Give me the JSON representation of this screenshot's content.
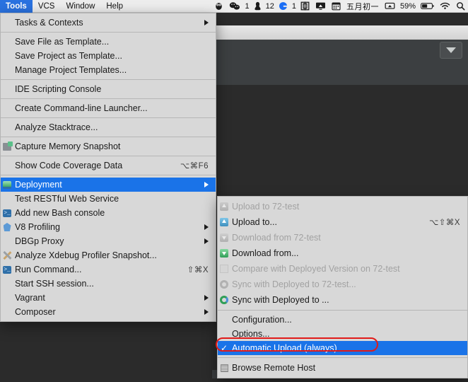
{
  "menubar": {
    "items": [
      {
        "label": "Tools",
        "active": true
      },
      {
        "label": "VCS",
        "active": false
      },
      {
        "label": "Window",
        "active": false
      },
      {
        "label": "Help",
        "active": false
      }
    ],
    "status_items": [
      {
        "name": "qq-penguin-icon",
        "glyph": "☻",
        "text": ""
      },
      {
        "name": "wechat-icon",
        "glyph": "◕◔",
        "text": "1"
      },
      {
        "name": "qq-contact-icon",
        "glyph": "♟",
        "text": "12"
      },
      {
        "name": "grammarly-icon",
        "glyph": "G",
        "text": "1"
      },
      {
        "name": "input-source-chinese-icon",
        "glyph": "中",
        "text": ""
      },
      {
        "name": "airplay-display-icon",
        "glyph": "⌷",
        "text": ""
      },
      {
        "name": "calendar-icon",
        "glyph": "▦",
        "text": ""
      },
      {
        "name": "lunar-date-label",
        "glyph": "",
        "text": "五月初一"
      },
      {
        "name": "screen-mirroring-icon",
        "glyph": "▭",
        "text": ""
      },
      {
        "name": "battery-percent-label",
        "glyph": "",
        "text": "59%"
      },
      {
        "name": "battery-icon",
        "glyph": "▰",
        "text": ""
      },
      {
        "name": "wifi-icon",
        "glyph": "◗",
        "text": ""
      },
      {
        "name": "spotlight-icon",
        "glyph": "⊜",
        "text": ""
      }
    ]
  },
  "tools_menu": {
    "name": "tools-menu",
    "items": [
      {
        "type": "item",
        "label": "Tasks & Contexts",
        "accel": "",
        "submenu": true,
        "icon": "",
        "selected": false,
        "disabled": false
      },
      {
        "type": "separator"
      },
      {
        "type": "item",
        "label": "Save File as Template...",
        "accel": "",
        "submenu": false,
        "icon": "",
        "selected": false,
        "disabled": false
      },
      {
        "type": "item",
        "label": "Save Project as Template...",
        "accel": "",
        "submenu": false,
        "icon": "",
        "selected": false,
        "disabled": false
      },
      {
        "type": "item",
        "label": "Manage Project Templates...",
        "accel": "",
        "submenu": false,
        "icon": "",
        "selected": false,
        "disabled": false
      },
      {
        "type": "separator"
      },
      {
        "type": "item",
        "label": "IDE Scripting Console",
        "accel": "",
        "submenu": false,
        "icon": "",
        "selected": false,
        "disabled": false
      },
      {
        "type": "separator"
      },
      {
        "type": "item",
        "label": "Create Command-line Launcher...",
        "accel": "",
        "submenu": false,
        "icon": "",
        "selected": false,
        "disabled": false
      },
      {
        "type": "separator"
      },
      {
        "type": "item",
        "label": "Analyze Stacktrace...",
        "accel": "",
        "submenu": false,
        "icon": "",
        "selected": false,
        "disabled": false
      },
      {
        "type": "separator"
      },
      {
        "type": "item",
        "label": "Capture Memory Snapshot",
        "accel": "",
        "submenu": false,
        "icon": "memory-snapshot-icon",
        "selected": false,
        "disabled": false
      },
      {
        "type": "separator"
      },
      {
        "type": "item",
        "label": "Show Code Coverage Data",
        "accel": "⌥⌘F6",
        "submenu": false,
        "icon": "",
        "selected": false,
        "disabled": false
      },
      {
        "type": "separator"
      },
      {
        "type": "item",
        "label": "Deployment",
        "accel": "",
        "submenu": true,
        "icon": "deployment-icon",
        "selected": true,
        "disabled": false
      },
      {
        "type": "item",
        "label": "Test RESTful Web Service",
        "accel": "",
        "submenu": false,
        "icon": "",
        "selected": false,
        "disabled": false
      },
      {
        "type": "item",
        "label": "Add new Bash console",
        "accel": "",
        "submenu": false,
        "icon": "bash-console-icon",
        "selected": false,
        "disabled": false
      },
      {
        "type": "item",
        "label": "V8 Profiling",
        "accel": "",
        "submenu": true,
        "icon": "v8-icon",
        "selected": false,
        "disabled": false
      },
      {
        "type": "item",
        "label": "DBGp Proxy",
        "accel": "",
        "submenu": true,
        "icon": "",
        "selected": false,
        "disabled": false
      },
      {
        "type": "item",
        "label": "Analyze Xdebug Profiler Snapshot...",
        "accel": "",
        "submenu": false,
        "icon": "xdebug-icon",
        "selected": false,
        "disabled": false
      },
      {
        "type": "item",
        "label": "Run Command...",
        "accel": "⇧⌘X",
        "submenu": false,
        "icon": "run-command-icon",
        "selected": false,
        "disabled": false
      },
      {
        "type": "item",
        "label": "Start SSH session...",
        "accel": "",
        "submenu": false,
        "icon": "",
        "selected": false,
        "disabled": false
      },
      {
        "type": "item",
        "label": "Vagrant",
        "accel": "",
        "submenu": true,
        "icon": "",
        "selected": false,
        "disabled": false
      },
      {
        "type": "item",
        "label": "Composer",
        "accel": "",
        "submenu": true,
        "icon": "",
        "selected": false,
        "disabled": false
      }
    ]
  },
  "deployment_menu": {
    "name": "deployment-submenu",
    "items": [
      {
        "type": "item",
        "label": "Upload to 72-test",
        "accel": "",
        "icon": "upload-icon",
        "disabled": true,
        "checked": false,
        "selected": false
      },
      {
        "type": "item",
        "label": "Upload to...",
        "accel": "⌥⇧⌘X",
        "icon": "upload-icon",
        "disabled": false,
        "checked": false,
        "selected": false
      },
      {
        "type": "item",
        "label": "Download from 72-test",
        "accel": "",
        "icon": "download-icon",
        "disabled": true,
        "checked": false,
        "selected": false
      },
      {
        "type": "item",
        "label": "Download from...",
        "accel": "",
        "icon": "download-icon",
        "disabled": false,
        "checked": false,
        "selected": false
      },
      {
        "type": "item",
        "label": "Compare with Deployed Version on 72-test",
        "accel": "",
        "icon": "compare-icon",
        "disabled": true,
        "checked": false,
        "selected": false
      },
      {
        "type": "item",
        "label": "Sync with Deployed to 72-test...",
        "accel": "",
        "icon": "sync-icon",
        "disabled": true,
        "checked": false,
        "selected": false
      },
      {
        "type": "item",
        "label": "Sync with Deployed to ...",
        "accel": "",
        "icon": "sync-icon",
        "disabled": false,
        "checked": false,
        "selected": false
      },
      {
        "type": "separator"
      },
      {
        "type": "item",
        "label": "Configuration...",
        "accel": "",
        "icon": "",
        "disabled": false,
        "checked": false,
        "selected": false
      },
      {
        "type": "item",
        "label": "Options...",
        "accel": "",
        "icon": "",
        "disabled": false,
        "checked": false,
        "selected": false
      },
      {
        "type": "item",
        "label": "Automatic Upload (always)",
        "accel": "",
        "icon": "",
        "disabled": false,
        "checked": true,
        "selected": true
      },
      {
        "type": "separator"
      },
      {
        "type": "item",
        "label": "Browse Remote Host",
        "accel": "",
        "icon": "remote-host-icon",
        "disabled": false,
        "checked": false,
        "selected": false
      }
    ]
  },
  "annotation": {
    "name": "red-highlight-ring",
    "target_label": "Automatic Upload (always)",
    "color": "#e11b19"
  },
  "colors": {
    "menu_bg": "#d8d8d8",
    "menu_selected": "#1a73e8",
    "menubar_bg": "#f6f6f6",
    "menubar_active": "#2a72e0",
    "ide_dark": "#2b2b2b",
    "ide_panel": "#3c3f41",
    "disabled_text": "#a2a2a2"
  }
}
